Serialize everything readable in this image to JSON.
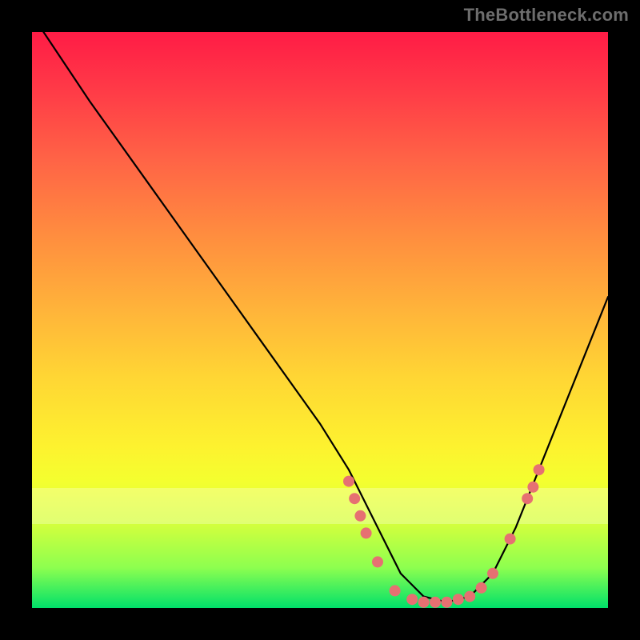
{
  "watermark": "TheBottleneck.com",
  "chart_data": {
    "type": "line",
    "title": "",
    "xlabel": "",
    "ylabel": "",
    "x_range": [
      0,
      100
    ],
    "y_range": [
      0,
      100
    ],
    "grid": false,
    "legend": false,
    "series": [
      {
        "name": "bottleneck-curve",
        "x": [
          2,
          10,
          20,
          30,
          40,
          50,
          55,
          60,
          64,
          68,
          72,
          76,
          80,
          84,
          88,
          92,
          96,
          100
        ],
        "y": [
          100,
          88,
          74,
          60,
          46,
          32,
          24,
          14,
          6,
          2,
          1,
          2,
          6,
          14,
          24,
          34,
          44,
          54
        ]
      }
    ],
    "points": [
      {
        "name": "cluster-left-upper",
        "x": 55,
        "y": 22
      },
      {
        "name": "cluster-left-upper2",
        "x": 56,
        "y": 19
      },
      {
        "name": "cluster-left-mid",
        "x": 57,
        "y": 16
      },
      {
        "name": "cluster-left-mid2",
        "x": 58,
        "y": 13
      },
      {
        "name": "cluster-left-low",
        "x": 60,
        "y": 8
      },
      {
        "name": "valley-1",
        "x": 63,
        "y": 3
      },
      {
        "name": "valley-2",
        "x": 66,
        "y": 1.5
      },
      {
        "name": "valley-3",
        "x": 68,
        "y": 1
      },
      {
        "name": "valley-4",
        "x": 70,
        "y": 1
      },
      {
        "name": "valley-5",
        "x": 72,
        "y": 1
      },
      {
        "name": "valley-6",
        "x": 74,
        "y": 1.5
      },
      {
        "name": "valley-7",
        "x": 76,
        "y": 2
      },
      {
        "name": "valley-8",
        "x": 78,
        "y": 3.5
      },
      {
        "name": "rise-1",
        "x": 80,
        "y": 6
      },
      {
        "name": "rise-2",
        "x": 83,
        "y": 12
      },
      {
        "name": "cluster-right-1",
        "x": 86,
        "y": 19
      },
      {
        "name": "cluster-right-2",
        "x": 87,
        "y": 21
      },
      {
        "name": "cluster-right-3",
        "x": 88,
        "y": 24
      }
    ],
    "color_scale": {
      "top": "#ff1c46",
      "mid": "#ffd634",
      "bottom": "#00e06a"
    }
  }
}
